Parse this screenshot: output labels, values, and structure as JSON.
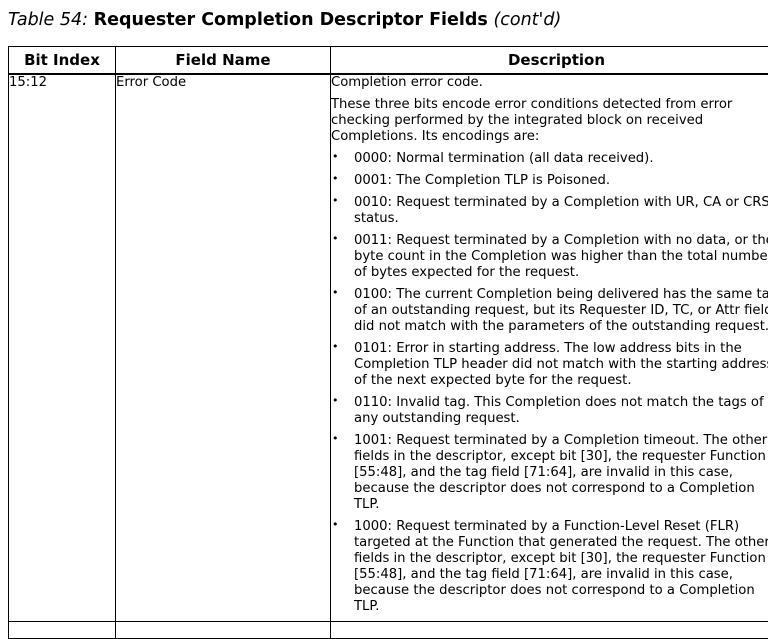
{
  "caption": {
    "label": "Table 54:",
    "title": "Requester Completion Descriptor Fields",
    "cont": "(cont'd)"
  },
  "table": {
    "headers": [
      "Bit Index",
      "Field Name",
      "Description"
    ],
    "row": {
      "bit_index": "15:12",
      "field_name": "Error Code",
      "intro": "Completion error code.",
      "paragraph": "These three bits encode error conditions detected from error checking performed by the integrated block on received Completions. Its encodings are:",
      "bullet_symbol": "•",
      "encodings": [
        "0000: Normal termination (all data received).",
        "0001: The Completion TLP is Poisoned.",
        "0010: Request terminated by a Completion with UR, CA or CRS status.",
        "0011: Request terminated by a Completion with no data, or the byte count in the Completion was higher than the total number of bytes expected for the request.",
        "0100: The current Completion being delivered has the same tag of an outstanding request, but its Requester ID, TC, or Attr fields did not match with the parameters of the outstanding request.",
        "0101: Error in starting address. The low address bits in the Completion TLP header did not match with the starting address of the next expected byte for the request.",
        "0110: Invalid tag. This Completion does not match the tags of any outstanding request.",
        "1001: Request terminated by a Completion timeout. The other fields in the descriptor, except bit [30], the requester Function [55:48], and the tag field [71:64], are invalid in this case, because the descriptor does not correspond to a Completion TLP.",
        "1000: Request terminated by a Function-Level Reset (FLR) targeted at the Function that generated the request. The other fields in the descriptor, except bit [30], the requester Function [55:48], and the tag field [71:64], are invalid in this case, because the descriptor does not correspond to a Completion TLP."
      ]
    }
  }
}
